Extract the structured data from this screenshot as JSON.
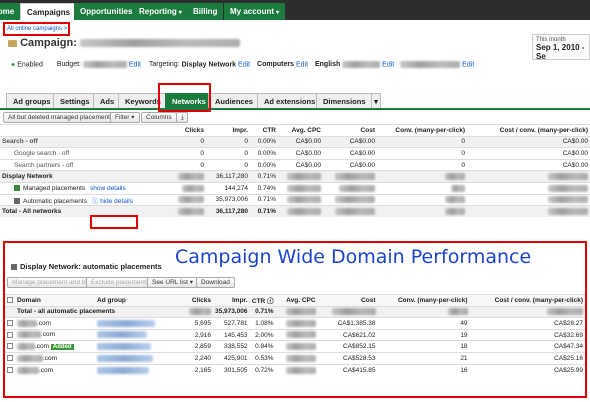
{
  "topnav": {
    "tabs": [
      {
        "label": "Home"
      },
      {
        "label": "Campaigns"
      },
      {
        "label": "Opportunities"
      },
      {
        "label": "Reporting"
      },
      {
        "label": "Billing"
      },
      {
        "label": "My account"
      }
    ]
  },
  "breadcrumb": "All online campaigns >",
  "campaign_label": "Campaign:",
  "date": {
    "label": "This month",
    "range": "Sep 1, 2010 - Se"
  },
  "settings": {
    "status": "Enabled",
    "budget_label": "Budget:",
    "edit": "Edit",
    "targeting_label": "Targeting:",
    "targeting_value": "Display Network",
    "computers": "Computers",
    "english": "English"
  },
  "subtabs": [
    "Ad groups",
    "Settings",
    "Ads",
    "Keywords",
    "Networks",
    "Audiences",
    "Ad extensions",
    "Dimensions"
  ],
  "toolbar": {
    "filter_select": "All but deleted managed placements",
    "filter": "Filter",
    "columns": "Columns"
  },
  "table1": {
    "headers": [
      "Clicks",
      "Impr.",
      "CTR",
      "Avg. CPC",
      "Cost",
      "Conv. (many-per-click)",
      "Cost / conv. (many-per-click)"
    ],
    "rows": [
      {
        "label": "Search - off",
        "clicks": "0",
        "impr": "0",
        "ctr": "0.00%",
        "cpc": "CA$0.00",
        "cost": "CA$0.00",
        "conv": "0",
        "costconv": "CA$0.00"
      },
      {
        "label": "Google search - off",
        "clicks": "0",
        "impr": "0",
        "ctr": "0.00%",
        "cpc": "CA$0.00",
        "cost": "CA$0.00",
        "conv": "0",
        "costconv": "CA$0.00"
      },
      {
        "label": "Search partners - off",
        "clicks": "0",
        "impr": "0",
        "ctr": "0.00%",
        "cpc": "CA$0.00",
        "cost": "CA$0.00",
        "conv": "0",
        "costconv": "CA$0.00"
      },
      {
        "label": "Display Network",
        "impr": "36,117,280",
        "ctr": "0.71%"
      },
      {
        "label": "Managed placements",
        "link": "show details",
        "impr": "144,274",
        "ctr": "0.74%"
      },
      {
        "label": "Automatic placements",
        "link": "hide details",
        "impr": "35,973,006",
        "ctr": "0.71%"
      },
      {
        "label": "Total - All networks",
        "impr": "36,117,280",
        "ctr": "0.71%"
      }
    ]
  },
  "overlay_title": "Campaign Wide Domain Performance",
  "section_title": "Display Network: automatic placements",
  "buttons": {
    "manage": "Manage placement and bid",
    "exclude": "Exclude placements",
    "see_url": "See URL list",
    "download": "Download"
  },
  "table2": {
    "headers": [
      "Domain",
      "Ad group",
      "Clicks",
      "Impr.",
      "CTR",
      "Avg. CPC",
      "Cost",
      "Conv. (many-per-click)",
      "Cost / conv. (many-per-click)"
    ],
    "total": {
      "label": "Total - all automatic placements",
      "impr": "35,973,006",
      "ctr": "0.71%"
    },
    "rows": [
      {
        "domain": ".com",
        "badge": "",
        "clicks": "5,695",
        "impr": "527,781",
        "ctr": "1.08%",
        "cost": "CA$1,385.38",
        "conv": "49",
        "costconv": "CA$28.27"
      },
      {
        "domain": ".com",
        "badge": "",
        "clicks": "2,916",
        "impr": "145,453",
        "ctr": "2.00%",
        "cost": "CA$621.02",
        "conv": "19",
        "costconv": "CA$32.69"
      },
      {
        "domain": ".com",
        "badge": "Added",
        "clicks": "2,859",
        "impr": "338,552",
        "ctr": "0.84%",
        "cost": "CA$852.15",
        "conv": "18",
        "costconv": "CA$47.34"
      },
      {
        "domain": ".com",
        "badge": "",
        "clicks": "2,240",
        "impr": "425,901",
        "ctr": "0.53%",
        "cost": "CA$528.53",
        "conv": "21",
        "costconv": "CA$25.16"
      },
      {
        "domain": ".com",
        "badge": "",
        "clicks": "2,165",
        "impr": "301,505",
        "ctr": "0.72%",
        "cost": "CA$415.85",
        "conv": "16",
        "costconv": "CA$25.99"
      }
    ]
  },
  "colors": {
    "nav_bg": "#2d2d2d",
    "green": "#1b7a3e",
    "highlight": "#e00000",
    "overlay_text": "#1a44c9"
  }
}
